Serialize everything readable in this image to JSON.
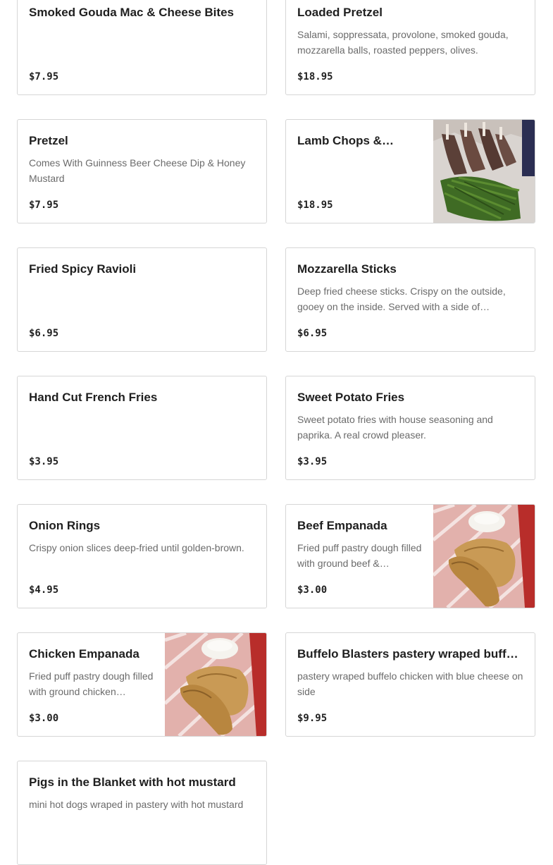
{
  "menu_items": [
    {
      "name": "Smoked Gouda Mac & Cheese Bites",
      "description": "",
      "price": "$7.95"
    },
    {
      "name": "Loaded Pretzel",
      "description": "Salami, soppressata, provolone, smoked gouda, mozzarella balls, roasted peppers, olives.",
      "price": "$18.95"
    },
    {
      "name": "Pretzel",
      "description": "Comes With Guinness Beer Cheese Dip & Honey Mustard",
      "price": "$7.95"
    },
    {
      "name": "Lamb Chops &…",
      "description": "",
      "price": "$18.95",
      "image": "lamb-chops-photo"
    },
    {
      "name": "Fried Spicy Ravioli",
      "description": "",
      "price": "$6.95"
    },
    {
      "name": "Mozzarella Sticks",
      "description": "Deep fried cheese sticks. Crispy on the outside, gooey on the inside. Served with a side of…",
      "price": "$6.95"
    },
    {
      "name": "Hand Cut French Fries",
      "description": "",
      "price": "$3.95"
    },
    {
      "name": "Sweet Potato Fries",
      "description": "Sweet potato fries with house seasoning and paprika. A real crowd pleaser.",
      "price": "$3.95"
    },
    {
      "name": "Onion Rings",
      "description": "Crispy onion slices deep-fried until golden-brown.",
      "price": "$4.95"
    },
    {
      "name": "Beef Empanada",
      "description": "Fried puff pastry dough filled with ground beef &…",
      "price": "$3.00",
      "image": "empanada-photo"
    },
    {
      "name": "Chicken Empanada",
      "description": "Fried puff pastry dough filled with ground chicken…",
      "price": "$3.00",
      "image": "empanada-photo"
    },
    {
      "name": "Buffelo Blasters pastery wraped buffelo…",
      "description": "pastery wraped buffelo chicken with blue cheese on side",
      "price": "$9.95"
    },
    {
      "name": "Pigs in the Blanket with hot mustard",
      "description": "mini hot dogs wraped in pastery with hot mustard",
      "price": ""
    }
  ]
}
